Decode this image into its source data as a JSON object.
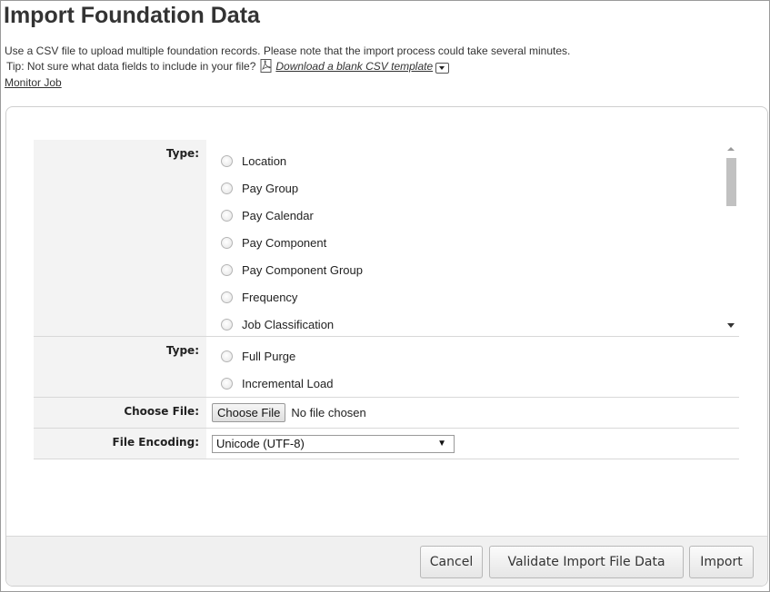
{
  "page": {
    "title": "Import Foundation Data",
    "description": "Use a CSV file to upload multiple foundation records. Please note that the import process could take several minutes.",
    "tip_prefix": "Tip: Not sure what data fields to include in your file?",
    "template_link": "Download a blank CSV template",
    "monitor_link": "Monitor Job"
  },
  "form": {
    "type_label": "Type:",
    "type_options": [
      "Location",
      "Pay Group",
      "Pay Calendar",
      "Pay Component",
      "Pay Component Group",
      "Frequency",
      "Job Classification"
    ],
    "load_type_label": "Type:",
    "load_type_options": [
      "Full Purge",
      "Incremental Load"
    ],
    "file_label": "Choose File:",
    "file_button": "Choose File",
    "file_status": "No file chosen",
    "encoding_label": "File Encoding:",
    "encoding_value": "Unicode (UTF-8)"
  },
  "buttons": {
    "cancel": "Cancel",
    "validate": "Validate Import File Data",
    "import": "Import"
  },
  "icons": {
    "pdf": "pdf-file-icon",
    "menu": "dropdown-menu-icon",
    "select_caret": "triangle-down-icon"
  }
}
